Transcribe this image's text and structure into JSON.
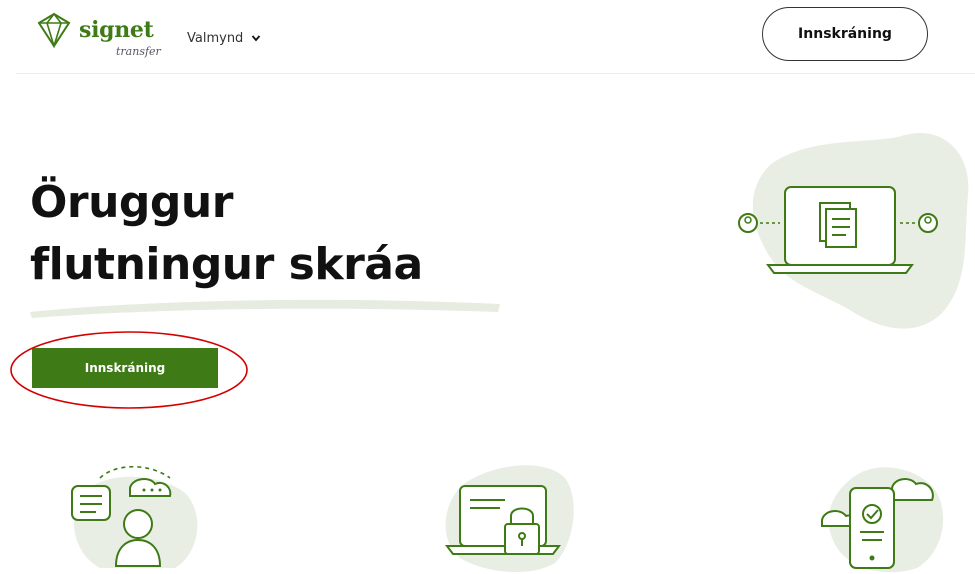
{
  "brand": {
    "name": "signet",
    "sub": "transfer",
    "accent": "#3e7a16",
    "blob": "#e9eee4"
  },
  "nav": {
    "menu_label": "Valmynd",
    "menu_icon": "chevron-down-icon"
  },
  "header": {
    "login_label": "Innskráning"
  },
  "hero": {
    "title_line1": "Öruggur",
    "title_line2": "flutningur skráa",
    "cta_label": "Innskráning",
    "annotation_color": "#d40000"
  },
  "illustrations": [
    {
      "icon": "laptop-documents-icon"
    },
    {
      "icon": "support-chat-icon"
    },
    {
      "icon": "laptop-lock-icon"
    },
    {
      "icon": "phone-cloud-check-icon"
    }
  ]
}
